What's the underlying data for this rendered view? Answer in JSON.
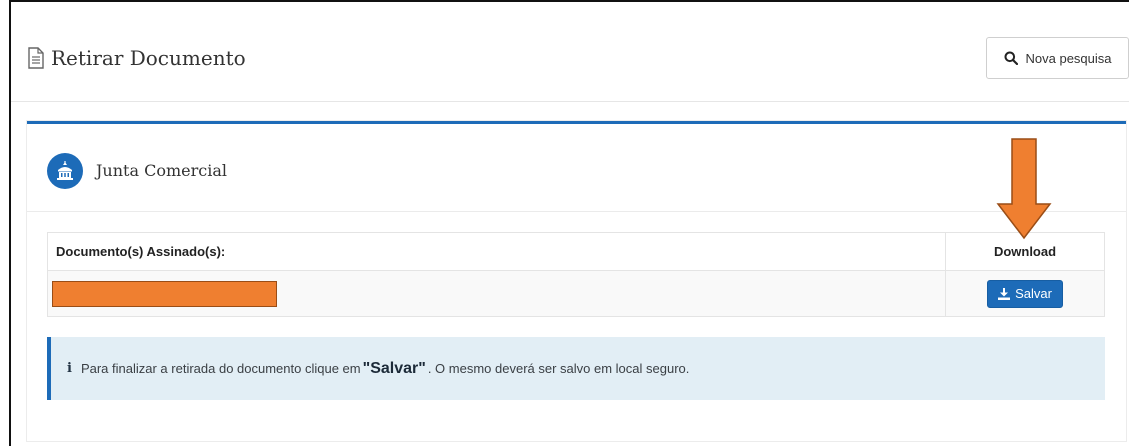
{
  "header": {
    "title": "Retirar Documento",
    "search_button_label": "Nova pesquisa"
  },
  "panel": {
    "org_name": "Junta Comercial",
    "table": {
      "columns": [
        "Documento(s) Assinado(s):",
        "Download"
      ],
      "rows": [
        {
          "document": "",
          "action_label": "Salvar"
        }
      ]
    },
    "info": {
      "before": "Para finalizar a retirada do documento clique em ",
      "emphasis": "\"Salvar\"",
      "after": ". O mesmo deverá ser salvo em local seguro."
    }
  },
  "colors": {
    "accent": "#1d6bb8",
    "info_background": "#e2eef5",
    "annotation_orange": "#ef7f30"
  },
  "icons": [
    "document-icon",
    "search-icon",
    "building-icon",
    "download-icon",
    "info-icon",
    "arrow-down-annotation"
  ]
}
